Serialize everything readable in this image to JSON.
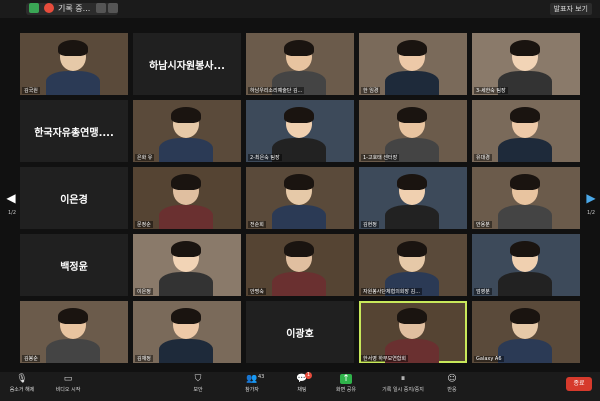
{
  "topbar": {
    "recording_label": "기록 중...",
    "speaker_view_label": "발표자 보기"
  },
  "tiles": [
    {
      "label": "김국원",
      "big": "",
      "active": false,
      "kind": "video"
    },
    {
      "label": "",
      "big": "하남시자원봉사...",
      "active": false,
      "kind": "name"
    },
    {
      "label": "하남우리소리예술단 김...",
      "big": "",
      "active": false,
      "kind": "video"
    },
    {
      "label": "한 임경",
      "big": "",
      "active": false,
      "kind": "video"
    },
    {
      "label": "3-세한숙 팀장",
      "big": "",
      "active": false,
      "kind": "video"
    },
    {
      "label": "",
      "big": "한국자유총연맹....",
      "active": false,
      "kind": "name"
    },
    {
      "label": "은화 유",
      "big": "",
      "active": false,
      "kind": "video"
    },
    {
      "label": "2-최은숙 팀장",
      "big": "",
      "active": false,
      "kind": "video"
    },
    {
      "label": "1-고호태 센터장",
      "big": "",
      "active": false,
      "kind": "video"
    },
    {
      "label": "유대경",
      "big": "",
      "active": false,
      "kind": "video"
    },
    {
      "label": "",
      "big": "이은경",
      "active": false,
      "kind": "name"
    },
    {
      "label": "문정순",
      "big": "",
      "active": false,
      "kind": "video"
    },
    {
      "label": "전순희",
      "big": "",
      "active": false,
      "kind": "video"
    },
    {
      "label": "김현정",
      "big": "",
      "active": false,
      "kind": "video"
    },
    {
      "label": "안용분",
      "big": "",
      "active": false,
      "kind": "video"
    },
    {
      "label": "",
      "big": "백정윤",
      "active": false,
      "kind": "name"
    },
    {
      "label": "이은정",
      "big": "",
      "active": false,
      "kind": "video"
    },
    {
      "label": "안명숙",
      "big": "",
      "active": false,
      "kind": "video"
    },
    {
      "label": "자원봉사단체협의회장 김...",
      "big": "",
      "active": false,
      "kind": "video"
    },
    {
      "label": "엄영분",
      "big": "",
      "active": false,
      "kind": "video"
    },
    {
      "label": "김봉순",
      "big": "",
      "active": false,
      "kind": "video"
    },
    {
      "label": "김재정",
      "big": "",
      "active": false,
      "kind": "video"
    },
    {
      "label": "",
      "big": "이광호",
      "active": false,
      "kind": "name"
    },
    {
      "label": "한서영 하부모연합회",
      "big": "",
      "active": true,
      "kind": "video"
    },
    {
      "label": "Galaxy A6",
      "big": "",
      "active": false,
      "kind": "video"
    }
  ],
  "nav": {
    "left_arrow": "◀",
    "right_arrow": "▶",
    "left_page": "1/2",
    "right_page": "1/2"
  },
  "toolbar": {
    "mute_label": "음소거 해제",
    "video_label": "비디오 시작",
    "security_label": "보안",
    "participants_label": "참가자",
    "participants_count": "43",
    "chat_label": "채팅",
    "chat_badge": "1",
    "share_label": "화면 공유",
    "record_label": "기록 일시 중지/중지",
    "reactions_label": "반응",
    "end_label": "종료"
  }
}
